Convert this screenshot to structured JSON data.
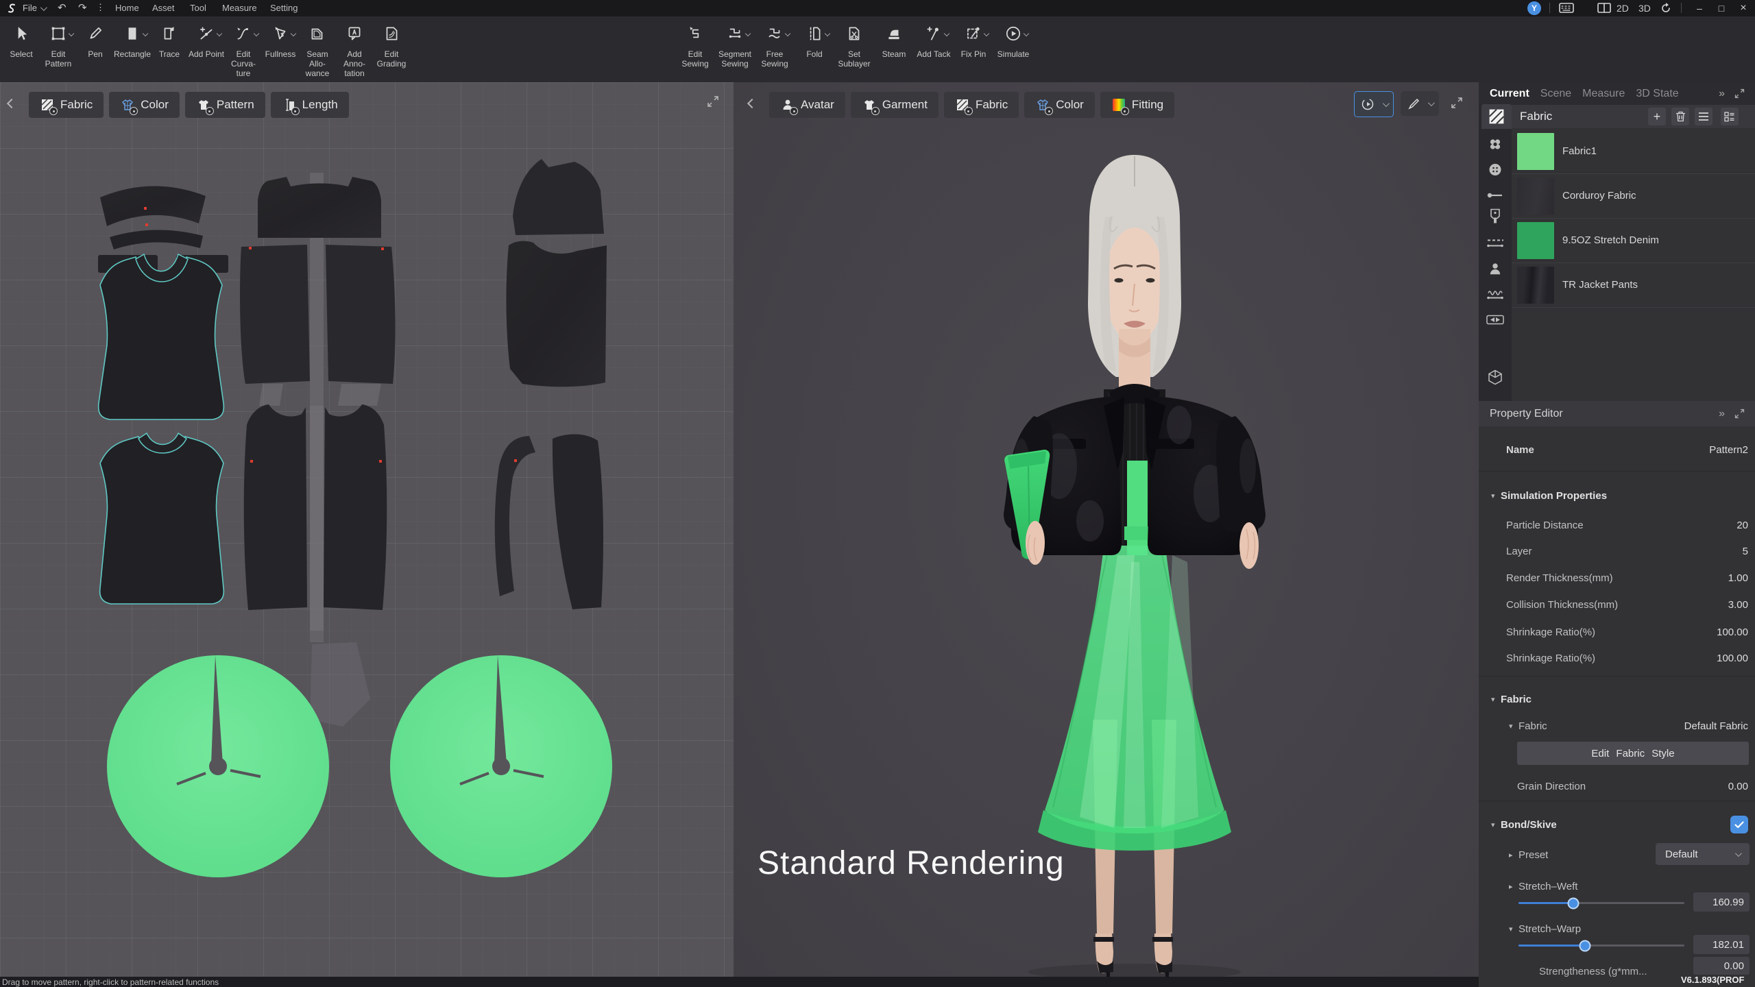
{
  "titlebar": {
    "file_label": "File",
    "menu_items": [
      "Home",
      "Asset",
      "Tool",
      "Measure",
      "Setting"
    ],
    "user_initial": "Y",
    "view_2d": "2D",
    "view_3d": "3D"
  },
  "toolbar": {
    "group1": [
      {
        "label": "Select",
        "dropdown": false
      },
      {
        "label": "Edit Pattern",
        "dropdown": true
      },
      {
        "label": "Pen",
        "dropdown": false
      },
      {
        "label": "Rectangle",
        "dropdown": true
      },
      {
        "label": "Trace",
        "dropdown": false
      },
      {
        "label": "Add Point",
        "dropdown": true
      },
      {
        "label": "Edit Curva-\nture",
        "dropdown": true
      },
      {
        "label": "Fullness",
        "dropdown": true
      },
      {
        "label": "Seam Allo-\nwance",
        "dropdown": false
      },
      {
        "label": "Add Anno-\ntation",
        "dropdown": false
      },
      {
        "label": "Edit Grading",
        "dropdown": false
      }
    ],
    "group2": [
      {
        "label": "Edit Sewing",
        "dropdown": false
      },
      {
        "label": "Segment\nSewing",
        "dropdown": true
      },
      {
        "label": "Free Sewing",
        "dropdown": true
      },
      {
        "label": "Fold",
        "dropdown": true
      },
      {
        "label": "Set Sublayer",
        "dropdown": false
      },
      {
        "label": "Steam",
        "dropdown": false
      },
      {
        "label": "Add Tack",
        "dropdown": true
      },
      {
        "label": "Fix Pin",
        "dropdown": true
      },
      {
        "label": "Simulate",
        "dropdown": true
      }
    ]
  },
  "pattern2d": {
    "tabs": [
      "Fabric",
      "Color",
      "Pattern",
      "Length"
    ]
  },
  "viewport3d": {
    "tabs": [
      "Avatar",
      "Garment",
      "Fabric",
      "Color",
      "Fitting"
    ],
    "render_mode_overlay": "Standard Rendering"
  },
  "right_panel": {
    "tabs": [
      "Current",
      "Scene",
      "Measure",
      "3D State"
    ],
    "fabric_list": {
      "title": "Fabric",
      "items": [
        {
          "name": "Fabric1",
          "swatch": "#72d883"
        },
        {
          "name": "Corduroy Fabric",
          "swatch": "#2e2d31"
        },
        {
          "name": "9.5OZ Stretch Denim",
          "swatch": "#2fa45c"
        },
        {
          "name": "TR Jacket Pants",
          "swatch": "#26252a"
        }
      ]
    },
    "property_editor": {
      "title": "Property Editor",
      "name_label": "Name",
      "name_value": "Pattern2",
      "simulation": {
        "title": "Simulation Properties",
        "rows": [
          {
            "label": "Particle Distance",
            "value": "20"
          },
          {
            "label": "Layer",
            "value": "5"
          },
          {
            "label": "Render Thickness(mm)",
            "value": "1.00"
          },
          {
            "label": "Collision Thickness(mm)",
            "value": "3.00"
          },
          {
            "label": "Shrinkage Ratio(%)",
            "value": "100.00"
          },
          {
            "label": "Shrinkage Ratio(%)",
            "value": "100.00"
          }
        ]
      },
      "fabric": {
        "title": "Fabric",
        "sub_label": "Fabric",
        "sub_value": "Default Fabric",
        "edit_button": "Edit Fabric Style",
        "grain_label": "Grain Direction",
        "grain_value": "0.00"
      },
      "bond": {
        "title": "Bond/Skive",
        "checked": true,
        "preset_label": "Preset",
        "preset_value": "Default",
        "weft_label": "Stretch–Weft",
        "weft_value": "160.99",
        "weft_percent": 33,
        "warp_label": "Stretch–Warp",
        "warp_value": "182.01",
        "warp_percent": 40,
        "strength_label": "Strengtheness (g*mm...",
        "strength_value": "0.00"
      }
    }
  },
  "statusbar": {
    "hint": "Drag to move pattern, right-click to pattern-related functions",
    "version": "V6.1.893(PROF"
  },
  "icons": {
    "tri_down": "▾",
    "tri_right": "▸",
    "more": "»",
    "undo": "↶",
    "redo": "↷",
    "kebab": "⋮",
    "minimize": "–",
    "maximize": "□",
    "close": "×",
    "plus": "+"
  },
  "colors": {
    "accent_blue": "#4a90e2",
    "skirt_green": "#4fe083",
    "pattern_circle_green": "#67e192",
    "fabric1_green": "#72d883",
    "denim_green": "#2fa45c"
  }
}
